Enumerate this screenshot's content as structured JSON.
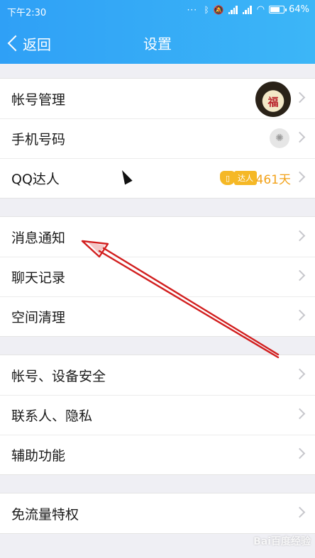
{
  "status_bar": {
    "time": "下午2:30",
    "icons": [
      "more-dots-icon",
      "bluetooth-icon",
      "mute-icon",
      "signal-icon",
      "signal-icon",
      "wifi-icon",
      "battery-icon"
    ],
    "battery_percent": "64%"
  },
  "nav": {
    "back_label": "返回",
    "title": "设置"
  },
  "groups": [
    {
      "items": [
        {
          "label": "帐号管理",
          "accessory": "avatar",
          "avatar_glyph": "福"
        },
        {
          "label": "手机号码",
          "accessory": "loader"
        },
        {
          "label": "QQ达人",
          "accessory": "badge",
          "badge_text": "达人",
          "days": "461天"
        }
      ]
    },
    {
      "items": [
        {
          "label": "消息通知"
        },
        {
          "label": "聊天记录"
        },
        {
          "label": "空间清理"
        }
      ]
    },
    {
      "items": [
        {
          "label": "帐号、设备安全"
        },
        {
          "label": "联系人、隐私"
        },
        {
          "label": "辅助功能"
        }
      ]
    },
    {
      "items": [
        {
          "label": "免流量特权"
        }
      ]
    }
  ],
  "watermark": "Bai百度经验",
  "colors": {
    "nav_bg": "#2fa0f6",
    "annotation_arrow": "#d21f1f",
    "qq_days": "#f2a21a"
  }
}
